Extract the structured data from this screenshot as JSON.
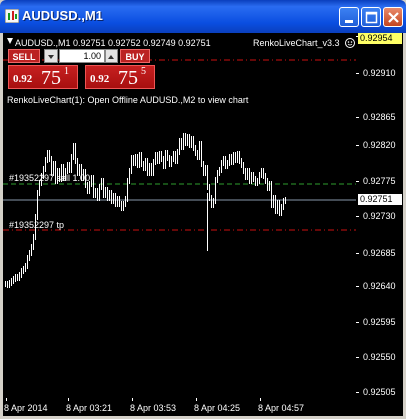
{
  "window": {
    "title": "AUDUSD.,M1"
  },
  "chart": {
    "symbol_info": "AUDUSD.,M1  0.92751 0.92752 0.92749 0.92751",
    "indicator_label": "RenkoLiveChart_v3.3",
    "comment": "RenkoLiveChart(1): Open Offline AUDUSD.,M2 to view chart",
    "current_price": "0.92751",
    "top_box_price": "0.92954",
    "price_ticks": [
      "0.92954",
      "0.92910",
      "0.92865",
      "0.92820",
      "0.92775",
      "0.92730",
      "0.92685",
      "0.92640",
      "0.92595",
      "0.92550",
      "0.92505"
    ],
    "time_ticks": [
      "8 Apr 2014",
      "8 Apr 03:21",
      "8 Apr 03:53",
      "8 Apr 04:25",
      "8 Apr 04:57"
    ],
    "colors": {
      "background": "#000000",
      "bars": "#ffffff",
      "sell_order": "#2e9e2e",
      "tp_line": "#cc1111",
      "bid_line": "#8899aa"
    }
  },
  "trade_panel": {
    "sell_label": "SELL",
    "buy_label": "BUY",
    "lot_value": "1.00",
    "sell_price_small": "0.92",
    "sell_price_big": "75",
    "sell_price_sup": "1",
    "buy_price_small": "0.92",
    "buy_price_big": "75",
    "buy_price_sup": "5"
  },
  "orders": {
    "sell_label": "#19352297 sell 1.00",
    "tp_label": "#19352297 tp"
  }
}
